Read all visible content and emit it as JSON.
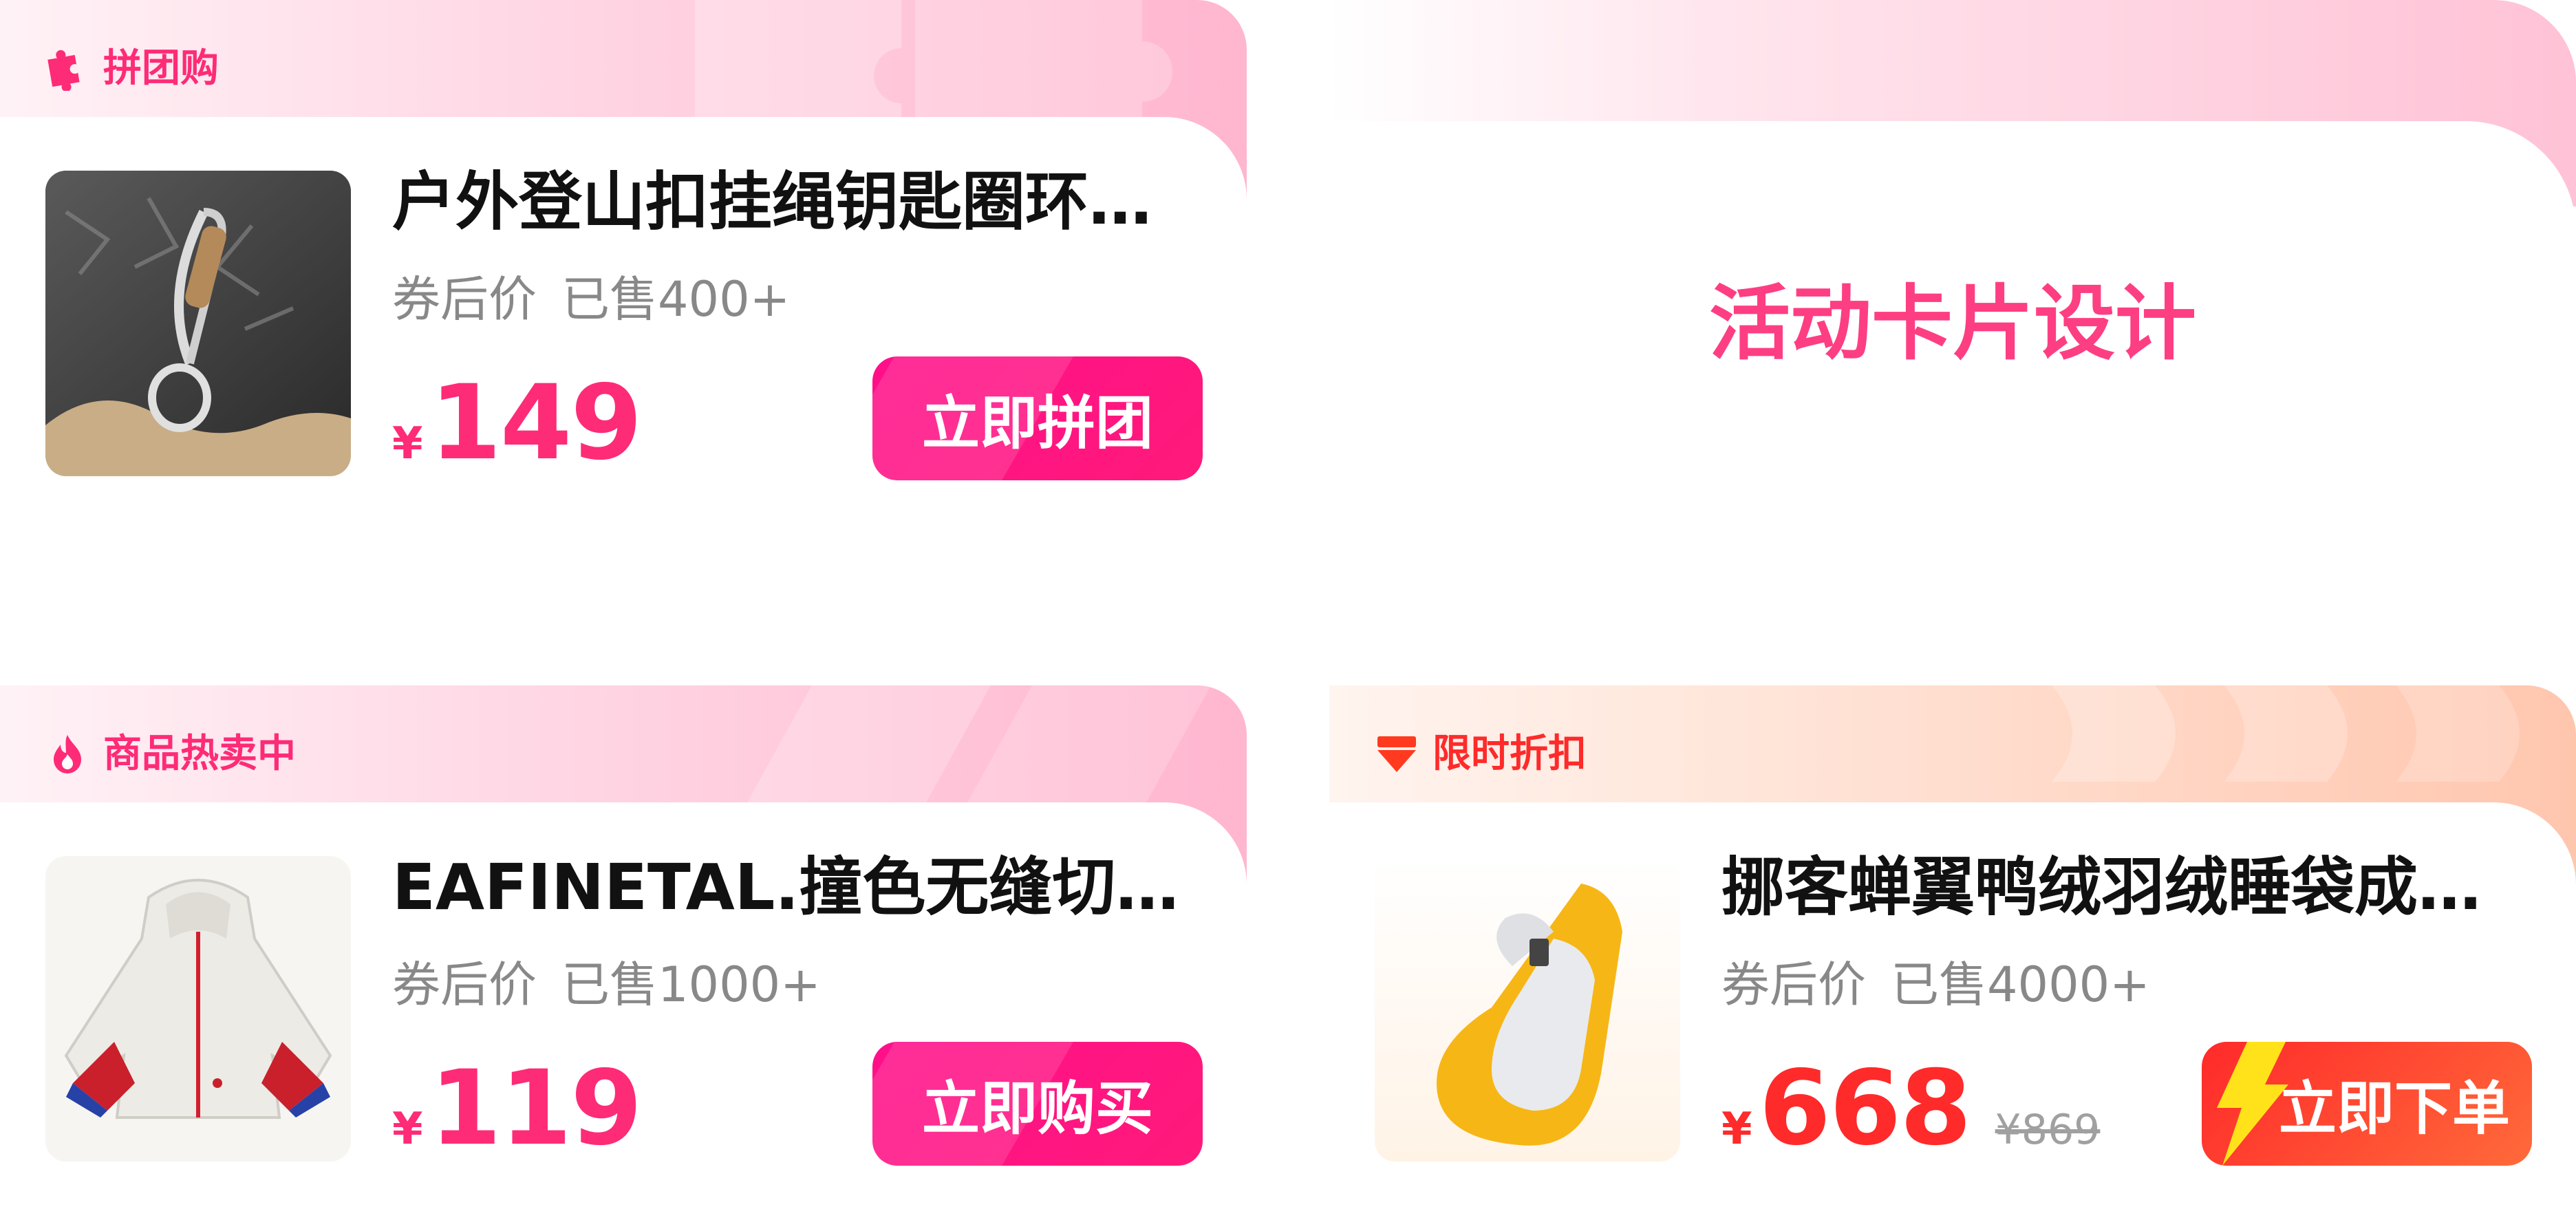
{
  "hero": {
    "title": "活动卡片设计"
  },
  "cards": [
    {
      "tag": "拼团购",
      "title": "户外登山扣挂绳钥匙圈环…",
      "coupon_label": "券后价",
      "sold": "已售400+",
      "currency": "¥",
      "price": "149",
      "button": "立即拼团",
      "icon": "puzzle-icon",
      "image": "keychain-carabiner-photo"
    },
    {
      "tag": "商品热卖中",
      "title": "EAFINETAL.撞色无缝切…",
      "coupon_label": "券后价",
      "sold": "已售1000+",
      "currency": "¥",
      "price": "119",
      "button": "立即购买",
      "icon": "flame-icon",
      "image": "white-jacket-photo"
    },
    {
      "tag": "限时折扣",
      "title": "挪客蝉翼鸭绒羽绒睡袋成…",
      "coupon_label": "券后价",
      "sold": "已售4000+",
      "currency": "¥",
      "price": "668",
      "original_price": "¥869",
      "button": "立即下单",
      "icon": "down-arrow-discount-icon",
      "image": "yellow-sleeping-bag-photo"
    }
  ],
  "colors": {
    "pink": "#fe2b77",
    "pink_button": "#ff0f8a",
    "orange_red": "#ff2a2a",
    "orange_button": "#ff5a2a",
    "hero_title": "#fe3e82"
  }
}
